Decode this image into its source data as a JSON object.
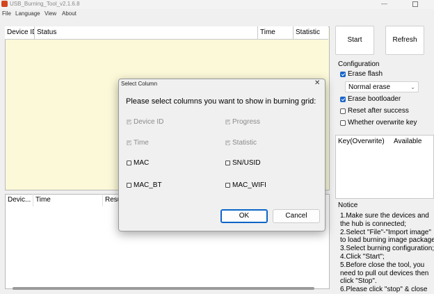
{
  "window": {
    "title": "USB_Burning_Tool_v2.1.6.8"
  },
  "menu": [
    "File",
    "Language",
    "View",
    "About"
  ],
  "grid": {
    "columns": [
      "Device ID",
      "Status",
      "Time",
      "Statistic"
    ]
  },
  "log_grid": {
    "columns": [
      "Devic...",
      "Time",
      "Resu"
    ]
  },
  "buttons": {
    "start": "Start",
    "refresh": "Refresh"
  },
  "configuration": {
    "label": "Configuration",
    "erase_flash": {
      "label": "Erase flash",
      "checked": true
    },
    "erase_mode": {
      "value": "Normal erase"
    },
    "erase_bootloader": {
      "label": "Erase bootloader",
      "checked": true
    },
    "reset_after_success": {
      "label": "Reset after success",
      "checked": false
    },
    "overwrite_key": {
      "label": "Whether overwrite key",
      "checked": false
    }
  },
  "key_table": {
    "columns": [
      "Key(Overwrite)",
      "Available"
    ]
  },
  "notice": {
    "label": "Notice",
    "text": "1.Make sure the devices and\nthe hub is connected;\n2.Select \"File\"-\"Import image\"\nto load burning image package\n3.Select burning configuration;\n4.Click \"Start\";\n5.Before close the tool, you\nneed to pull out devices then\nclick \"Stop\".\n6.Please click \"stop\" & close"
  },
  "dialog": {
    "title": "Select Column",
    "prompt": "Please select columns you want to show in burning grid:",
    "options": [
      {
        "label": "Device ID",
        "checked": true,
        "disabled": true
      },
      {
        "label": "Progress",
        "checked": true,
        "disabled": true
      },
      {
        "label": "Time",
        "checked": true,
        "disabled": true
      },
      {
        "label": "Statistic",
        "checked": true,
        "disabled": true
      },
      {
        "label": "MAC",
        "checked": false,
        "disabled": false
      },
      {
        "label": "SN/USID",
        "checked": false,
        "disabled": false
      },
      {
        "label": "MAC_BT",
        "checked": false,
        "disabled": false
      },
      {
        "label": "MAC_WIFI",
        "checked": false,
        "disabled": false
      }
    ],
    "ok": "OK",
    "cancel": "Cancel"
  },
  "colors": {
    "grid_bg": "#fbf9d8",
    "accent": "#1966c8"
  }
}
